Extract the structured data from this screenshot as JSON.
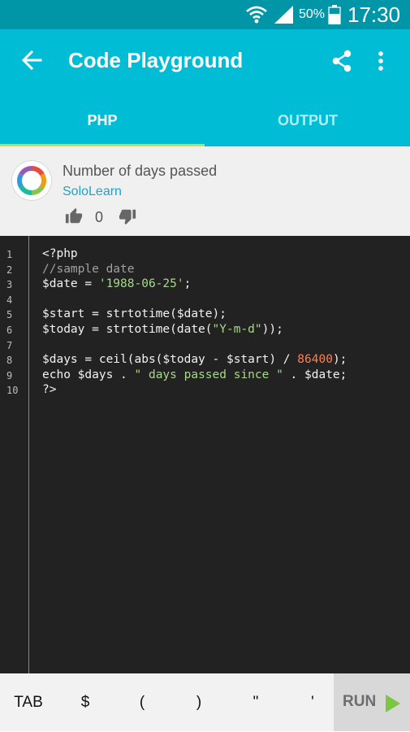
{
  "status_bar": {
    "battery_percent": "50%",
    "time": "17:30",
    "icons": [
      "wifi-icon",
      "signal-icon",
      "battery-icon"
    ]
  },
  "app_bar": {
    "title": "Code Playground",
    "icons": [
      "back-arrow-icon",
      "share-icon",
      "more-vert-icon"
    ],
    "tabs": [
      {
        "label": "PHP",
        "selected": true
      },
      {
        "label": "OUTPUT",
        "selected": false
      }
    ]
  },
  "code_info": {
    "name": "Number of days passed",
    "author": "SoloLearn",
    "votes": "0",
    "icons": [
      "sololearn-logo-icon",
      "thumb-up-icon",
      "thumb-down-icon"
    ]
  },
  "editor": {
    "line_numbers": [
      "1",
      "2",
      "3",
      "4",
      "5",
      "6",
      "7",
      "8",
      "9",
      "10"
    ],
    "lines": [
      [
        {
          "t": "<?php",
          "k": "plain"
        }
      ],
      [
        {
          "t": "//sample date",
          "k": "comment"
        }
      ],
      [
        {
          "t": "$date = ",
          "k": "plain"
        },
        {
          "t": "'1988-06-25'",
          "k": "string"
        },
        {
          "t": ";",
          "k": "plain"
        }
      ],
      [],
      [
        {
          "t": "$start = strtotime($date);",
          "k": "plain"
        }
      ],
      [
        {
          "t": "$today = strtotime(date(",
          "k": "plain"
        },
        {
          "t": "\"Y-m-d\"",
          "k": "string"
        },
        {
          "t": "));",
          "k": "plain"
        }
      ],
      [],
      [
        {
          "t": "$days = ceil(abs($today - $start) / ",
          "k": "plain"
        },
        {
          "t": "86400",
          "k": "number"
        },
        {
          "t": ");",
          "k": "plain"
        }
      ],
      [
        {
          "t": "echo $days . ",
          "k": "plain"
        },
        {
          "t": "\" days passed since \"",
          "k": "string"
        },
        {
          "t": " . $date;",
          "k": "plain"
        }
      ],
      [
        {
          "t": "?>",
          "k": "plain"
        }
      ]
    ]
  },
  "keybar": {
    "keys": [
      "TAB",
      "$",
      "(",
      ")",
      "\"",
      "'"
    ],
    "run_label": "RUN",
    "run_icon": "play-icon"
  },
  "colors": {
    "status_bar": "#0096a8",
    "app_bar": "#00bcd4",
    "tab_indicator": "#cddc39",
    "author_link": "#1ea3c9",
    "editor_bg": "#222222",
    "run_arrow": "#7cc644"
  }
}
